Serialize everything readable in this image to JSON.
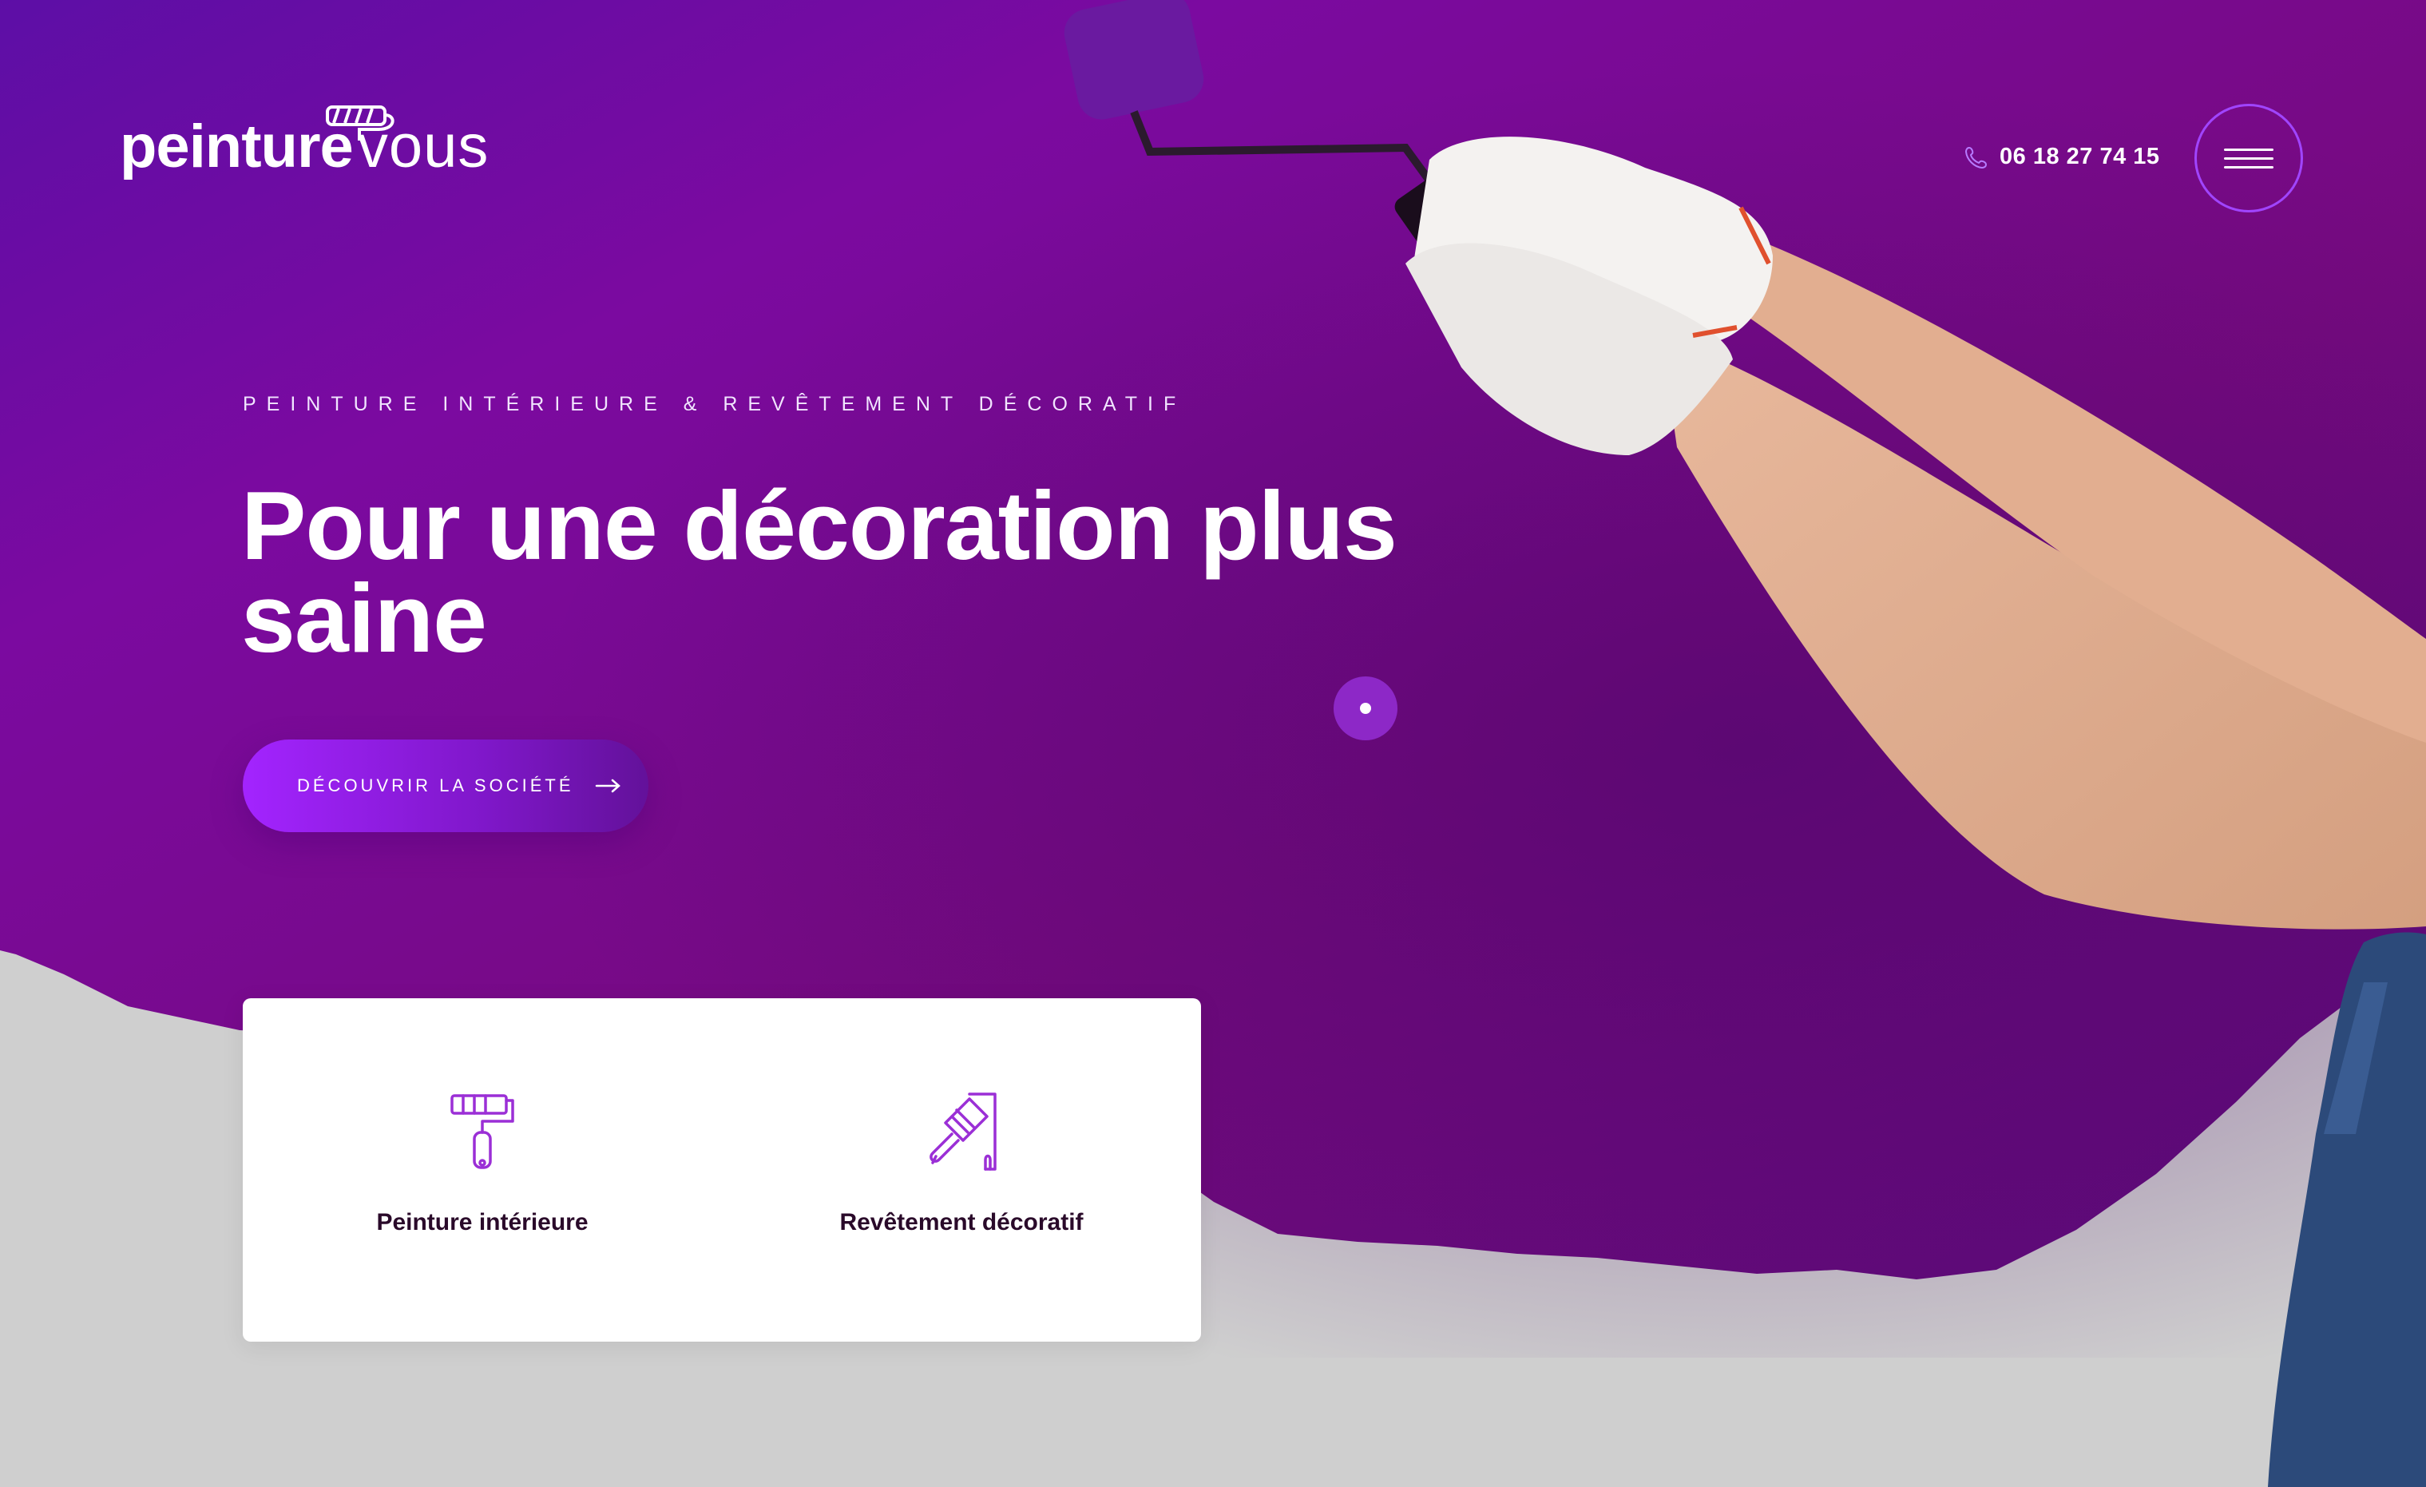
{
  "header": {
    "logo": {
      "part1": "peinture",
      "part2": "vous"
    },
    "phone": {
      "icon": "phone-icon",
      "number": "06 18 27 74 15"
    },
    "menu": {
      "icon": "hamburger-menu-icon"
    }
  },
  "hero": {
    "eyebrow": "PEINTURE INTÉRIEURE & REVÊTEMENT DÉCORATIF",
    "title": "Pour une décoration plus saine",
    "cta": {
      "label": "DÉCOUVRIR LA SOCIÉTÉ",
      "icon": "arrow-right-icon"
    }
  },
  "services": [
    {
      "label": "Peinture intérieure",
      "icon": "paint-roller-icon"
    },
    {
      "label": "Revêtement décoratif",
      "icon": "paint-brush-icon"
    }
  ],
  "colors": {
    "primary": "#8a11b8",
    "hero_dark": "#6e0878",
    "accent": "#a324ff",
    "wall": "#d0d0d0",
    "text_dark": "#2a0a2a"
  }
}
